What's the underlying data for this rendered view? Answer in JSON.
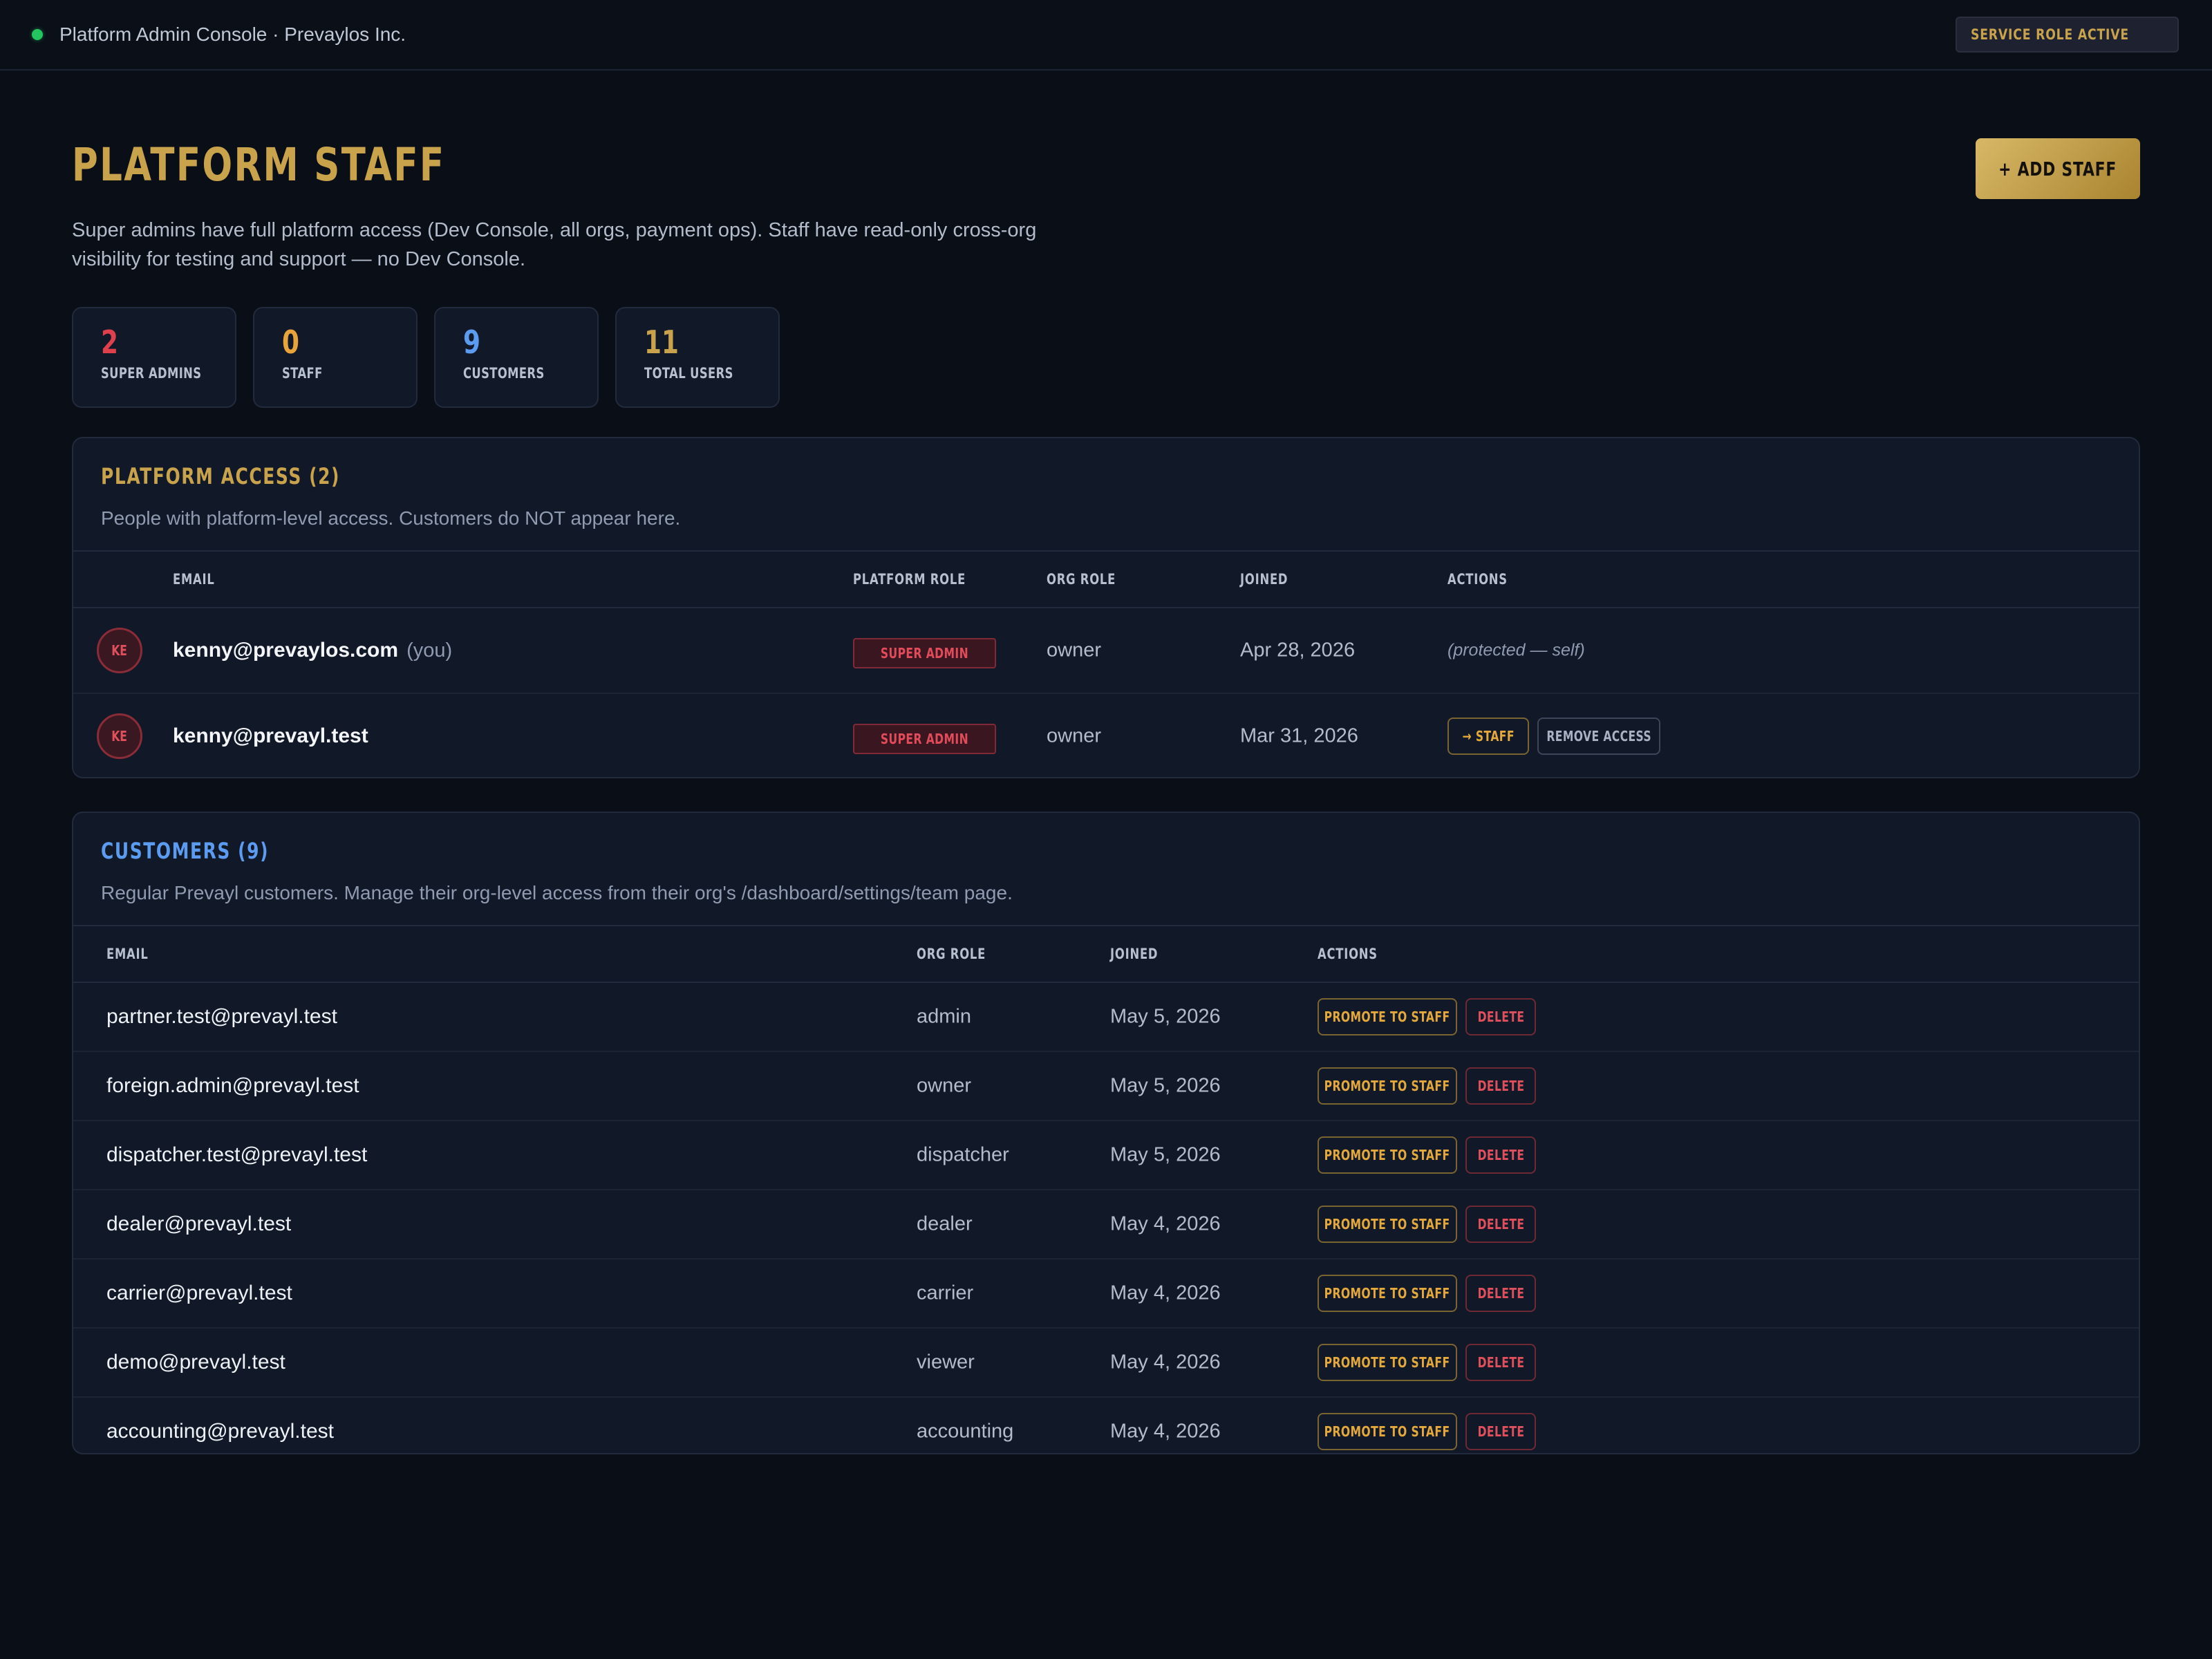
{
  "topbar": {
    "title": "Platform Admin Console · Prevaylos Inc.",
    "badge": "SERVICE ROLE ACTIVE"
  },
  "header": {
    "title": "PLATFORM STAFF",
    "add_button": "+ ADD STAFF",
    "subtitle": "Super admins have full platform access (Dev Console, all orgs, payment ops). Staff have read-only cross-org visibility for testing and support — no Dev Console."
  },
  "stats": [
    {
      "value": "2",
      "label": "SUPER ADMINS",
      "color": "#e0404c"
    },
    {
      "value": "0",
      "label": "STAFF",
      "color": "#e8a33a"
    },
    {
      "value": "9",
      "label": "CUSTOMERS",
      "color": "#5b9cf0"
    },
    {
      "value": "11",
      "label": "TOTAL USERS",
      "color": "#c9a24c"
    }
  ],
  "platform_access": {
    "title": "PLATFORM ACCESS (2)",
    "description": "People with platform-level access. Customers do NOT appear here.",
    "columns": {
      "email": "EMAIL",
      "platform_role": "PLATFORM ROLE",
      "org_role": "ORG ROLE",
      "joined": "JOINED",
      "actions": "ACTIONS"
    },
    "rows": [
      {
        "initials": "KE",
        "email": "kenny@prevaylos.com",
        "you": "(you)",
        "platform_role": "SUPER ADMIN",
        "org_role": "owner",
        "joined": "Apr 28, 2026",
        "protected": "(protected — self)"
      },
      {
        "initials": "KE",
        "email": "kenny@prevayl.test",
        "platform_role": "SUPER ADMIN",
        "org_role": "owner",
        "joined": "Mar 31, 2026",
        "action_staff": "→ STAFF",
        "action_remove": "REMOVE ACCESS"
      }
    ]
  },
  "customers": {
    "title": "CUSTOMERS (9)",
    "description": "Regular Prevayl customers. Manage their org-level access from their org's /dashboard/settings/team page.",
    "columns": {
      "email": "EMAIL",
      "org_role": "ORG ROLE",
      "joined": "JOINED",
      "actions": "ACTIONS"
    },
    "promote_label": "PROMOTE TO STAFF",
    "delete_label": "DELETE",
    "rows": [
      {
        "email": "partner.test@prevayl.test",
        "org_role": "admin",
        "joined": "May 5, 2026"
      },
      {
        "email": "foreign.admin@prevayl.test",
        "org_role": "owner",
        "joined": "May 5, 2026"
      },
      {
        "email": "dispatcher.test@prevayl.test",
        "org_role": "dispatcher",
        "joined": "May 5, 2026"
      },
      {
        "email": "dealer@prevayl.test",
        "org_role": "dealer",
        "joined": "May 4, 2026"
      },
      {
        "email": "carrier@prevayl.test",
        "org_role": "carrier",
        "joined": "May 4, 2026"
      },
      {
        "email": "demo@prevayl.test",
        "org_role": "viewer",
        "joined": "May 4, 2026"
      },
      {
        "email": "accounting@prevayl.test",
        "org_role": "accounting",
        "joined": "May 4, 2026"
      }
    ]
  },
  "colors": {
    "accent_gold": "#c9a24c",
    "customers_blue": "#5b9cf0",
    "danger_red": "#e0505c",
    "status_green": "#22c55e"
  }
}
